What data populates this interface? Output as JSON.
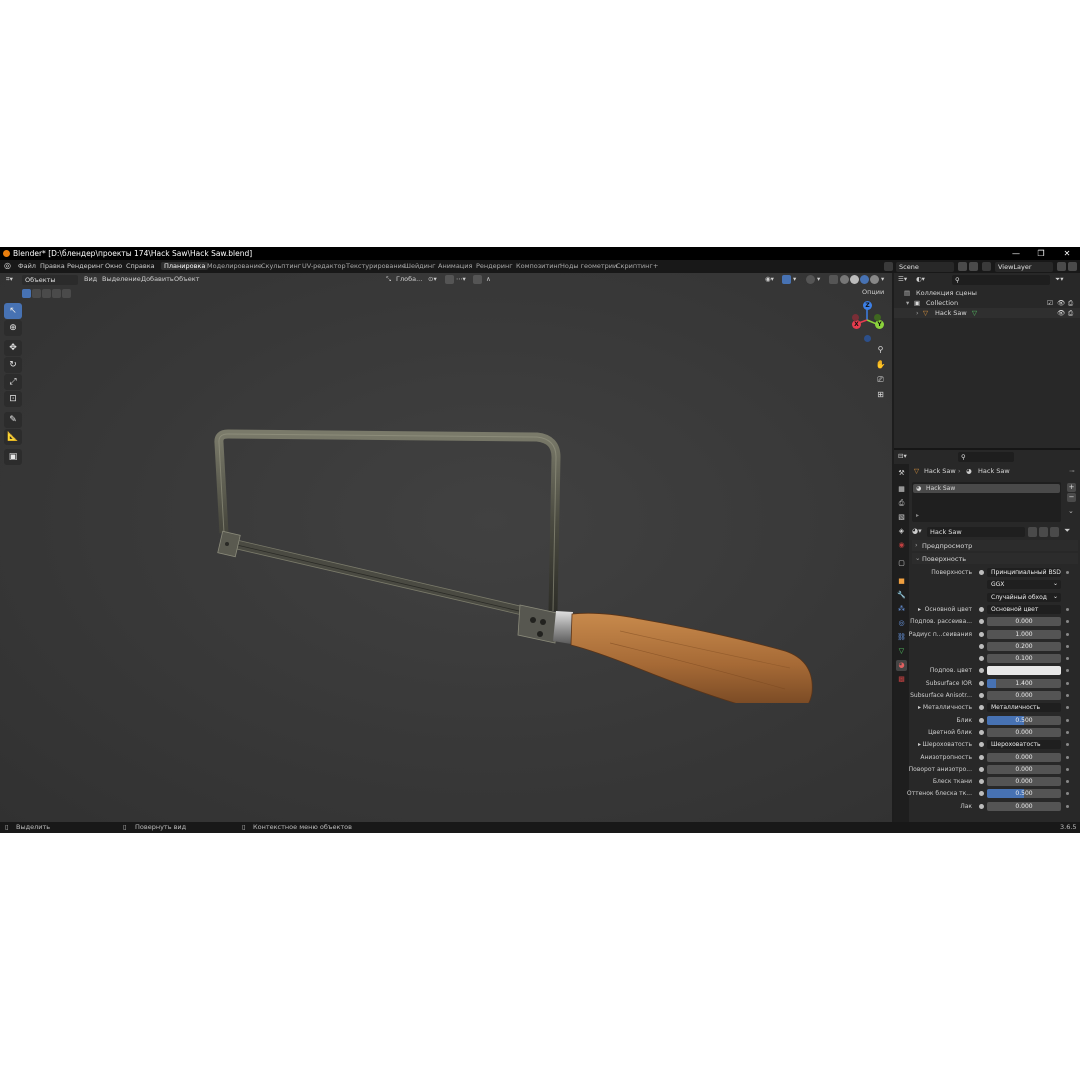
{
  "window": {
    "title": "Blender* [D:\\блендер\\проекты 174\\Hack Saw\\Hack Saw.blend]",
    "minimize": "—",
    "maximize": "❐",
    "close": "✕"
  },
  "menu": [
    "Файл",
    "Правка",
    "Рендеринг",
    "Окно",
    "Справка"
  ],
  "workspaces": [
    "Планировка",
    "Моделирование",
    "Скульптинг",
    "UV-редактор",
    "Текстурирование",
    "Шейдинг",
    "Анимация",
    "Рендеринг",
    "Композитинг",
    "Ноды геометрии",
    "Скриптинг",
    "+"
  ],
  "scene": {
    "name": "Scene",
    "view_layer": "ViewLayer"
  },
  "viewport_header": {
    "mode": "Объекты",
    "menus": [
      "Вид",
      "Выделение",
      "Добавить",
      "Объект"
    ],
    "transform_orientation": "Глоба...",
    "options": "Опции"
  },
  "gizmo": {
    "x": "X",
    "y": "Y",
    "z": "Z"
  },
  "outliner": {
    "root": "Коллекция сцены",
    "collection": "Collection",
    "object": "Hack Saw"
  },
  "properties": {
    "breadcrumb_object": "Hack Saw",
    "breadcrumb_material": "Hack Saw",
    "slot": "Hack Saw",
    "material_name": "Hack Saw",
    "section_preview": "Предпросмотр",
    "section_surface": "Поверхность",
    "rows": [
      {
        "label": "Поверхность",
        "value": "Принципиальный BSDF",
        "kind": "link"
      },
      {
        "label": "",
        "value": "GGX",
        "kind": "menu"
      },
      {
        "label": "",
        "value": "Случайный обход",
        "kind": "menu"
      },
      {
        "label": "Основной цвет",
        "value": "Основной цвет",
        "kind": "link",
        "arrow": true
      },
      {
        "label": "Подпов. рассеива...",
        "value": "0.000",
        "kind": "num",
        "fill": 0
      },
      {
        "label": "Радиус п...сеивания",
        "value": "1.000",
        "kind": "num",
        "fill": 0
      },
      {
        "label": "",
        "value": "0.200",
        "kind": "num",
        "fill": 0
      },
      {
        "label": "",
        "value": "0.100",
        "kind": "num",
        "fill": 0
      },
      {
        "label": "Подпов. цвет",
        "value": "",
        "kind": "color",
        "color": "#e8e8e8"
      },
      {
        "label": "Subsurface IOR",
        "value": "1.400",
        "kind": "num",
        "fill": 0.12
      },
      {
        "label": "Subsurface Anisotr...",
        "value": "0.000",
        "kind": "num",
        "fill": 0
      },
      {
        "label": "Металличность",
        "value": "Металличность",
        "kind": "link",
        "arrow": true
      },
      {
        "label": "Блик",
        "value": "0.500",
        "kind": "num",
        "fill": 0.5
      },
      {
        "label": "Цветной блик",
        "value": "0.000",
        "kind": "num",
        "fill": 0
      },
      {
        "label": "Шероховатость",
        "value": "Шероховатость",
        "kind": "link",
        "arrow": true
      },
      {
        "label": "Анизотропность",
        "value": "0.000",
        "kind": "num",
        "fill": 0
      },
      {
        "label": "Поворот анизотро...",
        "value": "0.000",
        "kind": "num",
        "fill": 0
      },
      {
        "label": "Блеск ткани",
        "value": "0.000",
        "kind": "num",
        "fill": 0
      },
      {
        "label": "Оттенок блеска тк...",
        "value": "0.500",
        "kind": "num",
        "fill": 0.5
      },
      {
        "label": "Лак",
        "value": "0.000",
        "kind": "num",
        "fill": 0
      }
    ]
  },
  "statusbar": {
    "select": "Выделить",
    "rotate": "Повернуть вид",
    "context": "Контекстное меню объектов",
    "version": "3.6.5"
  },
  "colors": {
    "accent": "#4772b3",
    "x_axis": "#e63c4e",
    "y_axis": "#8bd23c",
    "z_axis": "#3c7fe6",
    "logo": "#e87d0d"
  }
}
